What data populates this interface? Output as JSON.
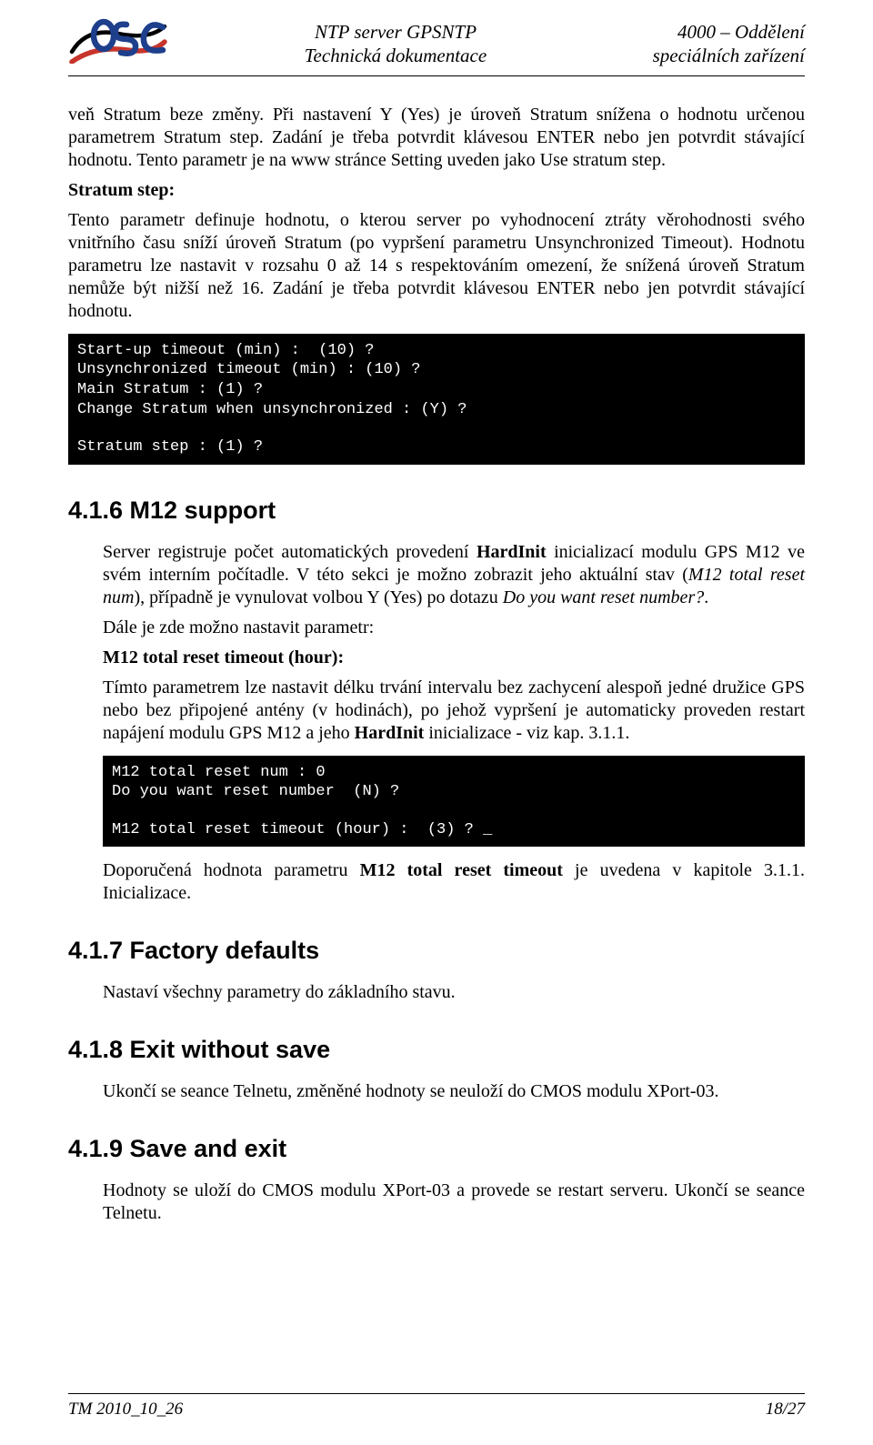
{
  "header": {
    "title_line1": "NTP server GPSNTP",
    "title_line2": "Technická dokumentace",
    "right_line1": "4000 – Oddělení",
    "right_line2": "speciálních zařízení"
  },
  "body": {
    "p1": "veň Stratum beze změny. Při nastavení Y (Yes) je úroveň Stratum snížena o hodnotu určenou parametrem Stratum step. Zadání je třeba potvrdit klávesou ENTER nebo jen potvrdit stávající hodnotu. Tento parametr je na www stránce Setting uveden jako Use stratum step.",
    "stratum_step_label": "Stratum step:",
    "p2": "Tento parametr definuje hodnotu, o kterou server po vyhodnocení ztráty věrohodnosti svého vnitřního času sníží úroveň Stratum (po vypršení parametru Unsynchronized Timeout). Hodnotu parametru lze nastavit v rozsahu 0 až 14 s respektováním omezení, že snížená úroveň Stratum nemůže být nižší než 16. Zadání je třeba potvrdit klávesou ENTER nebo jen potvrdit stávající hodnotu.",
    "terminal1": {
      "l1": "Start-up timeout (min) :  (10) ?",
      "l2": "Unsynchronized timeout (min) : (10) ?",
      "l3": "Main Stratum : (1) ?",
      "l4": "Change Stratum when unsynchronized : (Y) ?",
      "l5": "Stratum step : (1) ?"
    },
    "s416_title": "4.1.6 M12 support",
    "s416_p1_a": "Server registruje počet automatických provedení ",
    "s416_p1_bold1": "HardInit",
    "s416_p1_b": " inicializací modulu GPS M12 ve svém interním počítadle. V této sekci je možno zobrazit jeho aktuální stav (",
    "s416_p1_ital1": "M12 total reset num",
    "s416_p1_c": "), případně je vynulovat volbou Y (Yes) po dotazu ",
    "s416_p1_ital2": "Do you want reset number?",
    "s416_p1_d": ".",
    "s416_p2": "Dále je zde možno nastavit parametr:",
    "s416_label": "M12 total reset timeout (hour):",
    "s416_p3_a": "Tímto parametrem lze nastavit délku trvání intervalu bez zachycení alespoň jedné družice GPS nebo bez připojené antény (v hodinách), po jehož vypršení je automaticky proveden restart napájení modulu GPS M12 a jeho ",
    "s416_p3_bold": "HardInit",
    "s416_p3_b": " inicializace - viz kap. 3.1.1.",
    "terminal2": {
      "l1": "M12 total reset num : 0",
      "l2": "Do you want reset number  (N) ?",
      "l3": "M12 total reset timeout (hour) :  (3) ? _"
    },
    "s416_p4_a": "Doporučená hodnota parametru ",
    "s416_p4_bold": "M12 total reset timeout",
    "s416_p4_b": " je uvedena v kapitole 3.1.1. Inicializace.",
    "s417_title": "4.1.7 Factory defaults",
    "s417_p1": "Nastaví všechny parametry do základního stavu.",
    "s418_title": "4.1.8 Exit without save",
    "s418_p1": "Ukončí se seance Telnetu, změněné hodnoty se neuloží do CMOS modulu XPort-03.",
    "s419_title": "4.1.9 Save and exit",
    "s419_p1": "Hodnoty se uloží do CMOS modulu XPort-03 a provede se restart serveru. Ukončí se seance Telnetu."
  },
  "footer": {
    "left": "TM 2010_10_26",
    "right": "18/27"
  }
}
